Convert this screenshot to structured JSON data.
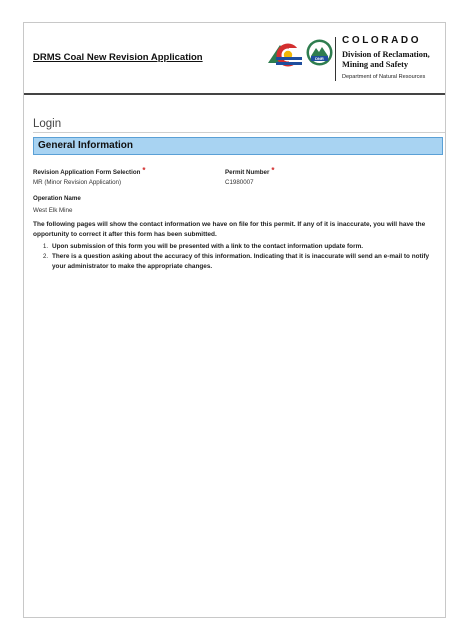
{
  "header": {
    "app_title": "DRMS Coal New Revision Application",
    "logo": {
      "state": "COLORADO",
      "agency_line1": "Division of Reclamation,",
      "agency_line2": "Mining and Safety",
      "department": "Department of Natural Resources",
      "badge_text": "DNR",
      "icons": [
        "colorado-c-flag-logo-icon",
        "dnr-mountain-badge-icon"
      ]
    }
  },
  "login": {
    "title": "Login"
  },
  "section": {
    "title": "General Information",
    "fields": {
      "revision_selection": {
        "label": "Revision Application Form Selection",
        "value": "MR (Minor Revision Application)",
        "required_mark": "*"
      },
      "permit_number": {
        "label": "Permit Number",
        "value": "C1980007",
        "required_mark": "*"
      },
      "operation_name": {
        "label": "Operation Name",
        "value": "West Elk Mine"
      }
    }
  },
  "info": {
    "intro": "The following pages will show the contact information we have on file for this permit. If any of it is inaccurate, you will have the opportunity to correct it after this form has been submitted.",
    "notes": [
      {
        "num": "1.",
        "text": "Upon submission of this form you will be presented with a link to the contact information update form."
      },
      {
        "num": "2.",
        "text": "There is a question asking about the accuracy of this information. Indicating that it is inaccurate will send an e-mail to notify your administrator to make the appropriate changes."
      }
    ]
  },
  "colors": {
    "section_bar": "#a8d3f2",
    "section_border": "#5aa0d6",
    "required": "#d12a2a",
    "logo_blue": "#1f4e9e",
    "logo_red": "#d32f2f",
    "logo_gold": "#f2b705",
    "logo_green": "#2e7d4f"
  }
}
